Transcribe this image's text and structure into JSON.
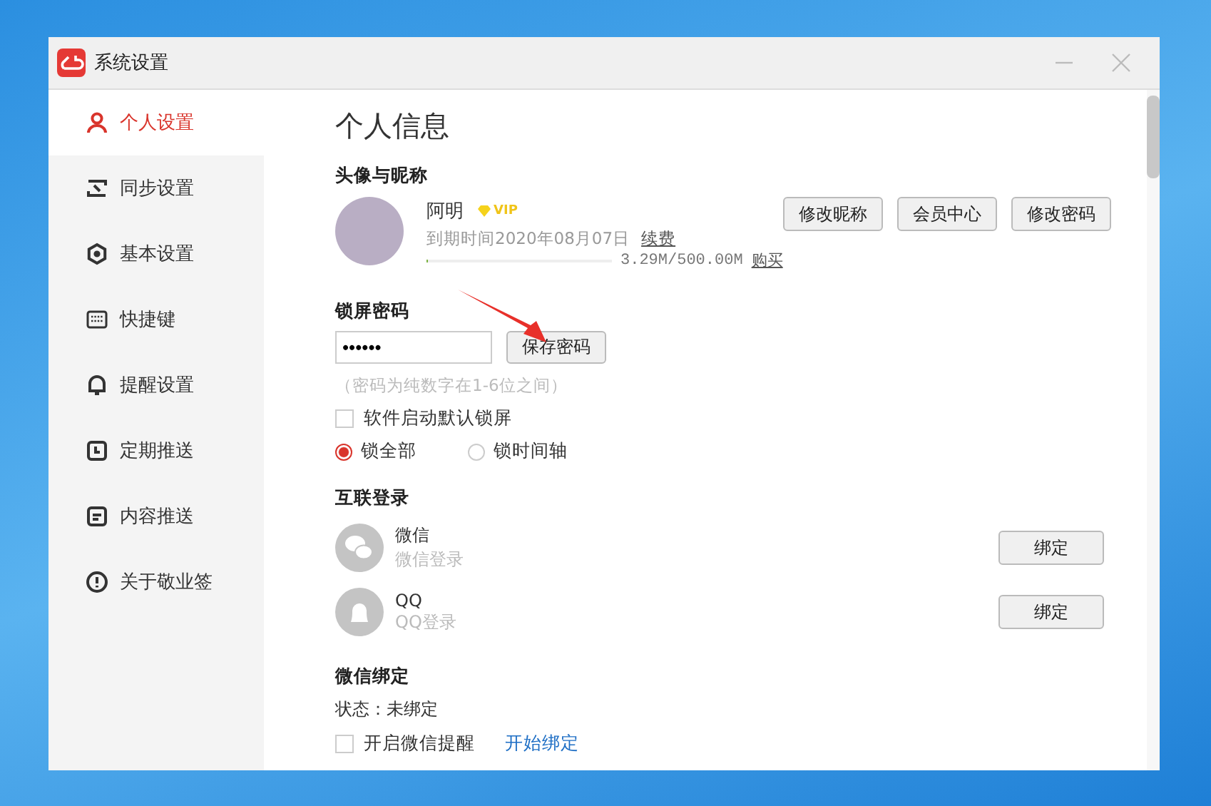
{
  "window": {
    "title": "系统设置"
  },
  "sidebar": {
    "items": [
      {
        "label": "个人设置",
        "selected": true,
        "kind": "user"
      },
      {
        "label": "同步设置",
        "selected": false,
        "kind": "sync"
      },
      {
        "label": "基本设置",
        "selected": false,
        "kind": "gear"
      },
      {
        "label": "快捷键",
        "selected": false,
        "kind": "keyboard"
      },
      {
        "label": "提醒设置",
        "selected": false,
        "kind": "bell"
      },
      {
        "label": "定期推送",
        "selected": false,
        "kind": "clock"
      },
      {
        "label": "内容推送",
        "selected": false,
        "kind": "doc"
      },
      {
        "label": "关于敬业签",
        "selected": false,
        "kind": "info"
      }
    ]
  },
  "page_title": "个人信息",
  "profile": {
    "heading": "头像与昵称",
    "name": "阿明",
    "badge": "VIP",
    "expiry": "到期时间2020年08月07日",
    "renew_link": "续费",
    "storage": {
      "level": 0.0066,
      "reading": "3.29M/500.00M",
      "buy_link": "购买"
    },
    "buttons": [
      "修改昵称",
      "会员中心",
      "修改密码"
    ]
  },
  "lock": {
    "heading": "锁屏密码",
    "password": "••••••",
    "save_button": "保存密码",
    "hint": "（密码为纯数字在1-6位之间）",
    "auto_lock": {
      "label": "软件启动默认锁屏",
      "checked": false
    },
    "modes": [
      {
        "label": "锁全部",
        "selected": true
      },
      {
        "label": "锁时间轴",
        "selected": false
      }
    ]
  },
  "social": {
    "heading": "互联登录",
    "accounts": [
      {
        "kind": "wechat",
        "name": "微信",
        "subtitle": "微信登录",
        "button": "绑定"
      },
      {
        "kind": "qq",
        "name": "QQ",
        "subtitle": "QQ登录",
        "button": "绑定"
      }
    ]
  },
  "wechat_binding": {
    "heading": "微信绑定",
    "status": "状态：未绑定",
    "notify": {
      "label": "开启微信提醒",
      "checked": false
    },
    "link": "开始绑定"
  }
}
